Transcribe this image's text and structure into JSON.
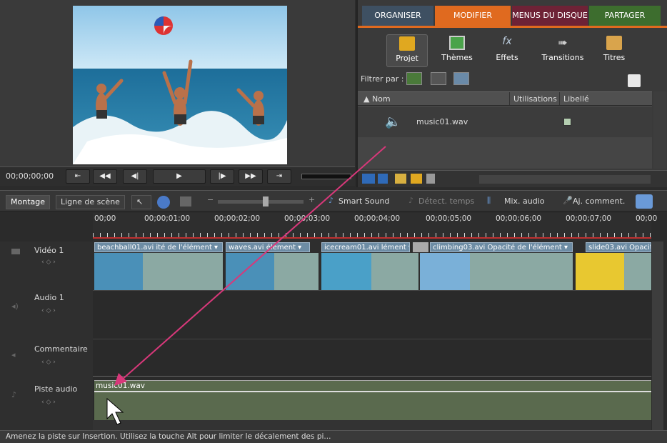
{
  "monitor": {
    "timecode": "00;00;00;00",
    "buttons": [
      "go-to-start",
      "rewind",
      "step-back",
      "play",
      "step-forward",
      "fast-forward",
      "go-to-end"
    ]
  },
  "tabs": [
    {
      "label": "ORGANISER",
      "color": "#3e5062"
    },
    {
      "label": "MODIFIER",
      "color": "#e06a1f"
    },
    {
      "label": "MENUS DU DISQUE",
      "color": "#6e2236"
    },
    {
      "label": "PARTAGER",
      "color": "#3d6d2e"
    }
  ],
  "tools": [
    {
      "label": "Projet",
      "icon": "film-folder-icon"
    },
    {
      "label": "Thèmes",
      "icon": "themes-icon"
    },
    {
      "label": "Effets",
      "icon": "fx-icon"
    },
    {
      "label": "Transitions",
      "icon": "transitions-icon"
    },
    {
      "label": "Titres",
      "icon": "titles-icon"
    }
  ],
  "filter": {
    "label": "Filtrer par :"
  },
  "list": {
    "col_name": "▲ Nom",
    "col_uses": "Utilisations",
    "col_label": "Libellé",
    "rows": [
      {
        "name": "music01.wav"
      }
    ]
  },
  "timeline_toolbar": {
    "montage": "Montage",
    "scene": "Ligne de scène",
    "smart_sound": "Smart Sound",
    "detect": "Détect. temps",
    "mix": "Mix. audio",
    "comment": "Aj. comment."
  },
  "ruler": [
    "00;00",
    "00;00;01;00",
    "00;00;02;00",
    "00;00;03;00",
    "00;00;04;00",
    "00;00;05;00",
    "00;00;06;00",
    "00;00;07;00",
    "00;00"
  ],
  "tracks": [
    {
      "name": "Vidéo 1"
    },
    {
      "name": "Audio 1"
    },
    {
      "name": "Commentaire"
    },
    {
      "name": "Piste audio"
    }
  ],
  "clips": [
    {
      "title": "beachball01.avi ité de l'élément ▾"
    },
    {
      "title": "waves.avi élément ▾"
    },
    {
      "title": "icecream01.avi lément ▾"
    },
    {
      "title": "climbing03.avi Opacité de l'élément ▾"
    },
    {
      "title": "slide03.avi Opacit"
    }
  ],
  "audio_clip": {
    "title": "music01.wav"
  },
  "status": "Amenez la piste sur Insertion. Utilisez la touche Alt pour limiter le décalement des pi..."
}
